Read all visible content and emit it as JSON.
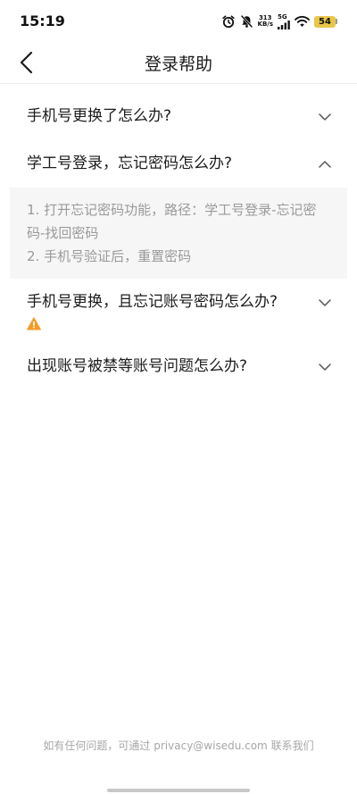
{
  "status_bar": {
    "time": "15:19",
    "net_speed_value": "313",
    "net_speed_unit": "KB/s",
    "network": "5G",
    "battery": "54",
    "icons": [
      "alarm-icon",
      "mute-bell-icon",
      "signal-icon",
      "wifi-icon",
      "battery-icon"
    ]
  },
  "header": {
    "title": "登录帮助",
    "back_icon": "chevron-left-icon"
  },
  "faq": {
    "items": [
      {
        "question": "手机号更换了怎么办?",
        "expanded": false
      },
      {
        "question": "学工号登录，忘记密码怎么办?",
        "expanded": true,
        "answer": [
          "1. 打开忘记密码功能，路径：学工号登录-忘记密码-找回密码",
          "2. 手机号验证后，重置密码"
        ]
      },
      {
        "question": "手机号更换，且忘记账号密码怎么办?",
        "expanded": false,
        "warning_icon": "warning-icon"
      },
      {
        "question": "出现账号被禁等账号问题怎么办?",
        "expanded": false
      }
    ]
  },
  "footer": {
    "prefix": "如有任何问题，可通过",
    "email": "privacy@wisedu.com",
    "suffix": "联系我们"
  },
  "colors": {
    "accent_warning": "#f59a23",
    "answer_background": "#f6f6f6",
    "battery": "#e8c64a"
  }
}
